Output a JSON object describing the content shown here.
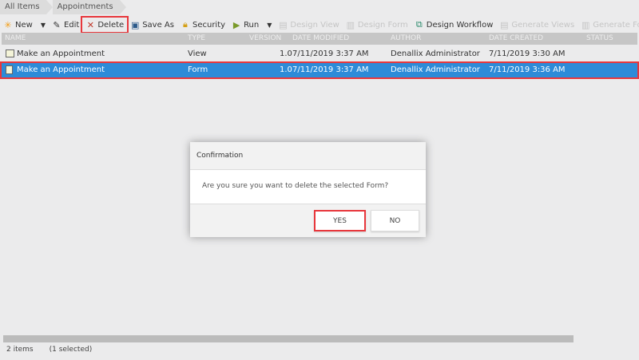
{
  "breadcrumb": [
    "All Items",
    "Appointments"
  ],
  "toolbar": {
    "new": "New",
    "edit": "Edit",
    "delete": "Delete",
    "save_as": "Save As",
    "security": "Security",
    "run": "Run",
    "design_view": "Design View",
    "design_form": "Design Form",
    "design_workflow": "Design Workflow",
    "generate_views": "Generate Views",
    "generate_forms": "Generate Forms"
  },
  "columns": {
    "name": "NAME",
    "type": "TYPE",
    "version": "VERSION",
    "date_modified": "DATE MODIFIED",
    "author": "AUTHOR",
    "date_created": "DATE CREATED",
    "status": "STATUS"
  },
  "rows": [
    {
      "name": "Make an Appointment",
      "type": "View",
      "version": "1.0",
      "date_modified": "7/11/2019 3:37 AM",
      "author": "Denallix Administrator",
      "date_created": "7/11/2019 3:30 AM"
    },
    {
      "name": "Make an Appointment",
      "type": "Form",
      "version": "1.0",
      "date_modified": "7/11/2019 3:37 AM",
      "author": "Denallix Administrator",
      "date_created": "7/11/2019 3:36 AM"
    }
  ],
  "dialog": {
    "title": "Confirmation",
    "message": "Are you sure you want to delete the selected Form?",
    "yes": "YES",
    "no": "NO"
  },
  "status": {
    "count": "2 items",
    "selected": "(1 selected)"
  }
}
